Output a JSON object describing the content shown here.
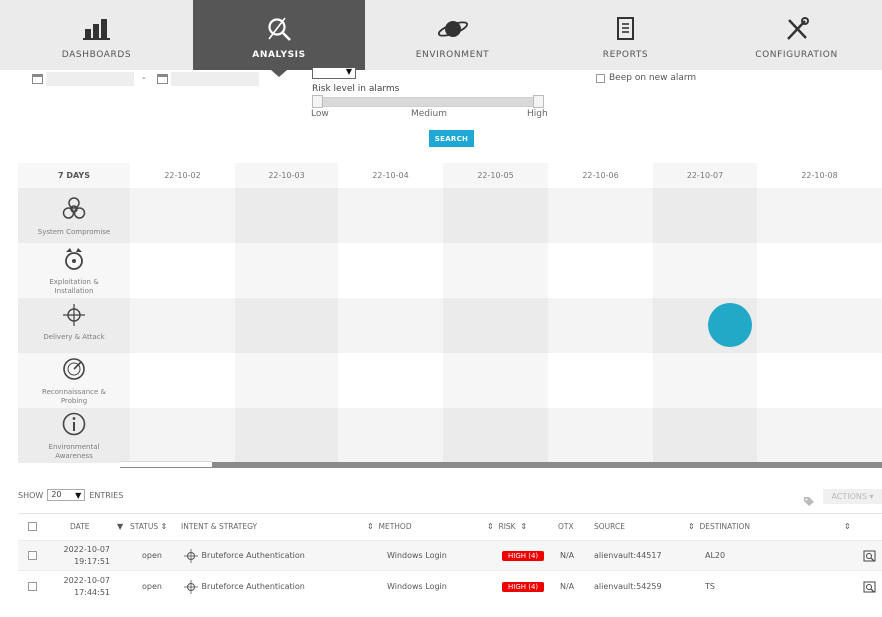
{
  "nav": {
    "items": [
      {
        "label": "DASHBOARDS",
        "icon": "bar-chart-icon"
      },
      {
        "label": "ANALYSIS",
        "icon": "magnifier-icon",
        "active": true
      },
      {
        "label": "ENVIRONMENT",
        "icon": "planet-icon"
      },
      {
        "label": "REPORTS",
        "icon": "report-icon"
      },
      {
        "label": "CONFIGURATION",
        "icon": "tools-icon"
      }
    ]
  },
  "filters": {
    "date_separator": "-",
    "risk_label": "Risk level in alarms",
    "risk_ticks": [
      "Low",
      "Medium",
      "High"
    ],
    "search_label": "SEARCH",
    "beep_label": "Beep on new alarm"
  },
  "timeline": {
    "range_label": "7 DAYS",
    "days": [
      "22-10-02",
      "22-10-03",
      "22-10-04",
      "22-10-05",
      "22-10-06",
      "22-10-07",
      "22-10-08"
    ],
    "categories": [
      {
        "label": "System Compromise",
        "icon": "biohazard-icon"
      },
      {
        "label": "Exploitation & Installation",
        "icon": "bomb-icon"
      },
      {
        "label": "Delivery & Attack",
        "icon": "crosshair-icon"
      },
      {
        "label": "Reconnaissance & Probing",
        "icon": "radar-icon"
      },
      {
        "label": "Environmental Awareness",
        "icon": "info-icon"
      }
    ],
    "alarm_marker": {
      "day": "22-10-07",
      "category": "Delivery & Attack"
    },
    "accent": "#23a9c8"
  },
  "table": {
    "show_label": "SHOW",
    "entries_value": "20",
    "entries_label": "ENTRIES",
    "actions_label": "ACTIONS",
    "columns": [
      "DATE",
      "STATUS",
      "INTENT & STRATEGY",
      "METHOD",
      "RISK",
      "OTX",
      "SOURCE",
      "DESTINATION"
    ],
    "rows": [
      {
        "date": "2022-10-07",
        "time": "19:17:51",
        "status": "open",
        "intent": "Bruteforce Authentication",
        "method": "Windows Login",
        "risk": "HIGH (4)",
        "otx": "N/A",
        "source": "alienvault:44517",
        "destination": "AL20"
      },
      {
        "date": "2022-10-07",
        "time": "17:44:51",
        "status": "open",
        "intent": "Bruteforce Authentication",
        "method": "Windows Login",
        "risk": "HIGH (4)",
        "otx": "N/A",
        "source": "alienvault:54259",
        "destination": "TS"
      }
    ],
    "risk_color": "#ee0000"
  }
}
